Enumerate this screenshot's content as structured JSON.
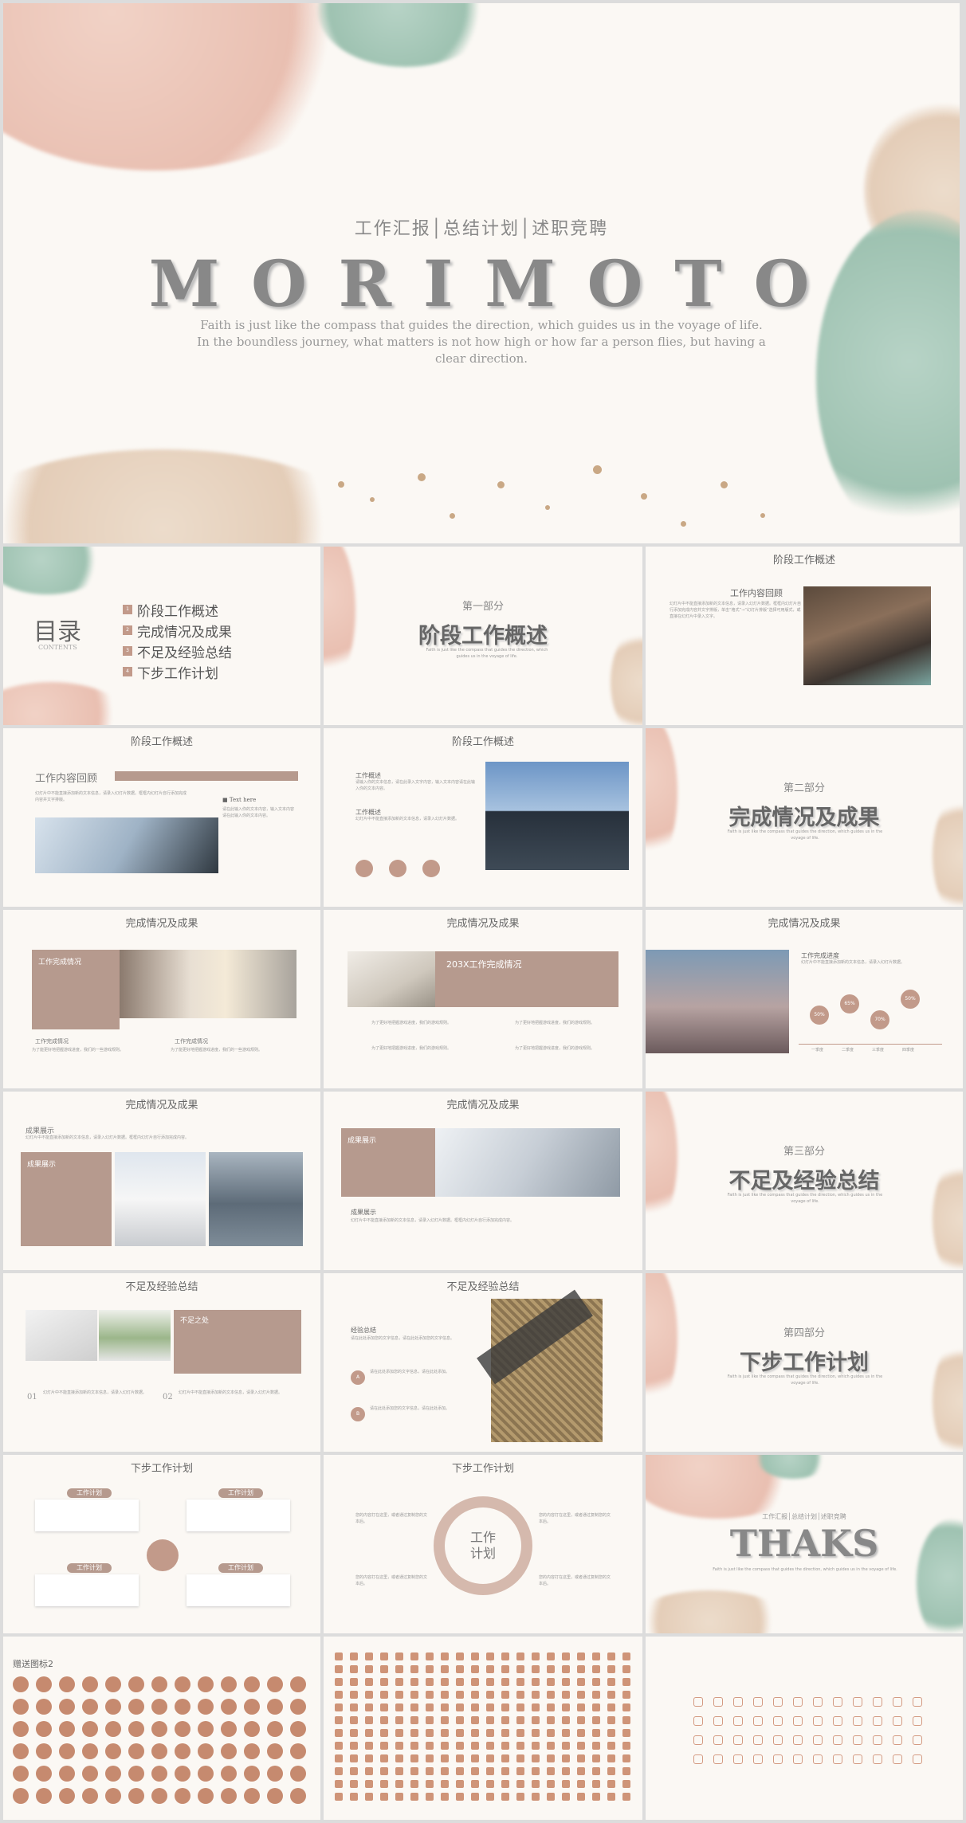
{
  "cover": {
    "subtitle": "工作汇报│总结计划│述职竞聘",
    "title": "M O R I M O T O",
    "tagline": "Faith is just like the compass that guides the direction, which guides us in the voyage of life. In the boundless journey, what matters is not how high or how far a person flies, but having a clear direction."
  },
  "toc": {
    "title": "目录",
    "sub": "CONTENTS",
    "items": [
      "阶段工作概述",
      "完成情况及成果",
      "不足及经验总结",
      "下步工作计划"
    ],
    "nums": [
      "1",
      "2",
      "3",
      "4"
    ]
  },
  "parts": [
    {
      "label": "第一部分",
      "title": "阶段工作概述"
    },
    {
      "label": "第二部分",
      "title": "完成情况及成果"
    },
    {
      "label": "第三部分",
      "title": "不足及经验总结"
    },
    {
      "label": "第四部分",
      "title": "下步工作计划"
    }
  ],
  "headers": {
    "s1": "阶段工作概述",
    "s2": "完成情况及成果",
    "s3": "不足及经验总结",
    "s4": "下步工作计划"
  },
  "slide3": {
    "heading": "工作内容回顾"
  },
  "slide4": {
    "heading": "工作内容回顾",
    "bullet": "■ Text here"
  },
  "slide5": {
    "h1": "工作概述",
    "h2": "工作概述"
  },
  "slide7": {
    "box": "工作完成情况",
    "l1": "工作完成情况",
    "l2": "工作完成情况"
  },
  "slide8": {
    "box": "203X工作完成情况"
  },
  "slide9": {
    "heading": "工作完成进度",
    "pcts": [
      "50%",
      "65%",
      "70%",
      "50%"
    ],
    "quarters": [
      "一季度",
      "二季度",
      "三季度",
      "四季度"
    ]
  },
  "slide10": {
    "heading": "成果展示",
    "box": "成果展示"
  },
  "slide11": {
    "box": "成果展示",
    "heading": "成果展示"
  },
  "slide13": {
    "box": "不足之处",
    "n1": "01",
    "n2": "02"
  },
  "slide14": {
    "heading": "经验总结",
    "a": "A",
    "b": "B"
  },
  "slide16": {
    "labels": [
      "工作计划",
      "工作计划",
      "工作计划",
      "工作计划"
    ]
  },
  "slide17": {
    "center": "工作\n计划"
  },
  "thanks": {
    "sub": "工作汇报│总结计划│述职竞聘",
    "title": "THAKS"
  },
  "icons": {
    "title": "赠送图标2"
  }
}
